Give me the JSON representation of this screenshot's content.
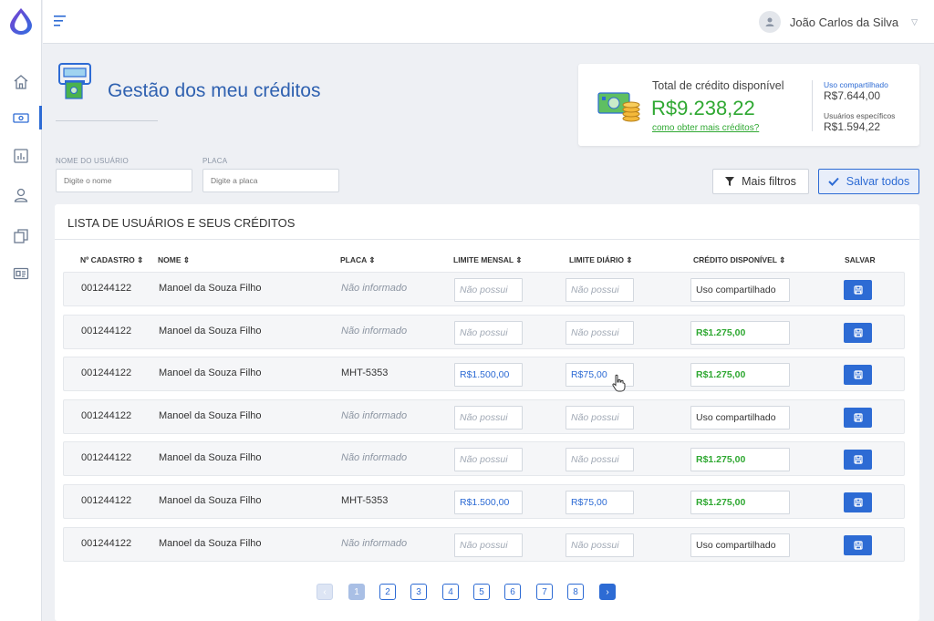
{
  "header": {
    "user_name": "João Carlos da Silva"
  },
  "page": {
    "title": "Gestão dos meu créditos"
  },
  "credit": {
    "total_label": "Total de crédito disponível",
    "total_value": "R$9.238,22",
    "link": "como obter mais créditos?",
    "shared_label": "Uso compartilhado",
    "shared_value": "R$7.644,00",
    "specific_label": "Usuários específicos",
    "specific_value": "R$1.594,22"
  },
  "filters": {
    "name_label": "NOME DO USUÁRIO",
    "name_placeholder": "Digite o nome",
    "plate_label": "PLACA",
    "plate_placeholder": "Digite a placa",
    "more_filters": "Mais filtros",
    "save_all": "Salvar todos"
  },
  "list": {
    "title": "LISTA DE USUÁRIOS E SEUS CRÉDITOS",
    "columns": [
      "Nº CADASTRO ⇕",
      "NOME ⇕",
      "PLACA ⇕",
      "LIMITE MENSAL ⇕",
      "LIMITE DIÁRIO ⇕",
      "CRÉDITO DISPONÍVEL ⇕",
      "SALVAR"
    ],
    "rows": [
      {
        "id": "001244122",
        "name": "Manoel da Souza Filho",
        "plate": "Não informado",
        "monthly": "Não possui",
        "daily": "Não possui",
        "credit": "Uso compartilhado"
      },
      {
        "id": "001244122",
        "name": "Manoel da Souza Filho",
        "plate": "Não informado",
        "monthly": "Não possui",
        "daily": "Não possui",
        "credit": "R$1.275,00"
      },
      {
        "id": "001244122",
        "name": "Manoel da Souza Filho",
        "plate": "MHT-5353",
        "monthly": "R$1.500,00",
        "daily": "R$75,00",
        "credit": "R$1.275,00"
      },
      {
        "id": "001244122",
        "name": "Manoel da Souza Filho",
        "plate": "Não informado",
        "monthly": "Não possui",
        "daily": "Não possui",
        "credit": "Uso compartilhado"
      },
      {
        "id": "001244122",
        "name": "Manoel da Souza Filho",
        "plate": "Não informado",
        "monthly": "Não possui",
        "daily": "Não possui",
        "credit": "R$1.275,00"
      },
      {
        "id": "001244122",
        "name": "Manoel da Souza Filho",
        "plate": "MHT-5353",
        "monthly": "R$1.500,00",
        "daily": "R$75,00",
        "credit": "R$1.275,00"
      },
      {
        "id": "001244122",
        "name": "Manoel da Souza Filho",
        "plate": "Não informado",
        "monthly": "Não possui",
        "daily": "Não possui",
        "credit": "Uso compartilhado"
      }
    ]
  },
  "pagination": {
    "prev": "‹",
    "pages": [
      "1",
      "2",
      "3",
      "4",
      "5",
      "6",
      "7",
      "8"
    ],
    "current": "1",
    "next": "›"
  },
  "icons": {
    "logo": "drop-logo-icon",
    "menu": "hamburger-menu-icon",
    "sidebar": [
      "home-icon",
      "money-icon",
      "chart-icon",
      "user-icon",
      "documents-icon",
      "id-card-icon"
    ],
    "avatar": "user-avatar-icon",
    "filter": "filter-icon",
    "check": "check-icon",
    "row_save": "floppy-disk-icon"
  },
  "colors": {
    "primary": "#2d6bd4",
    "credit_green": "#2fa832",
    "title_blue": "#2f61b0"
  }
}
